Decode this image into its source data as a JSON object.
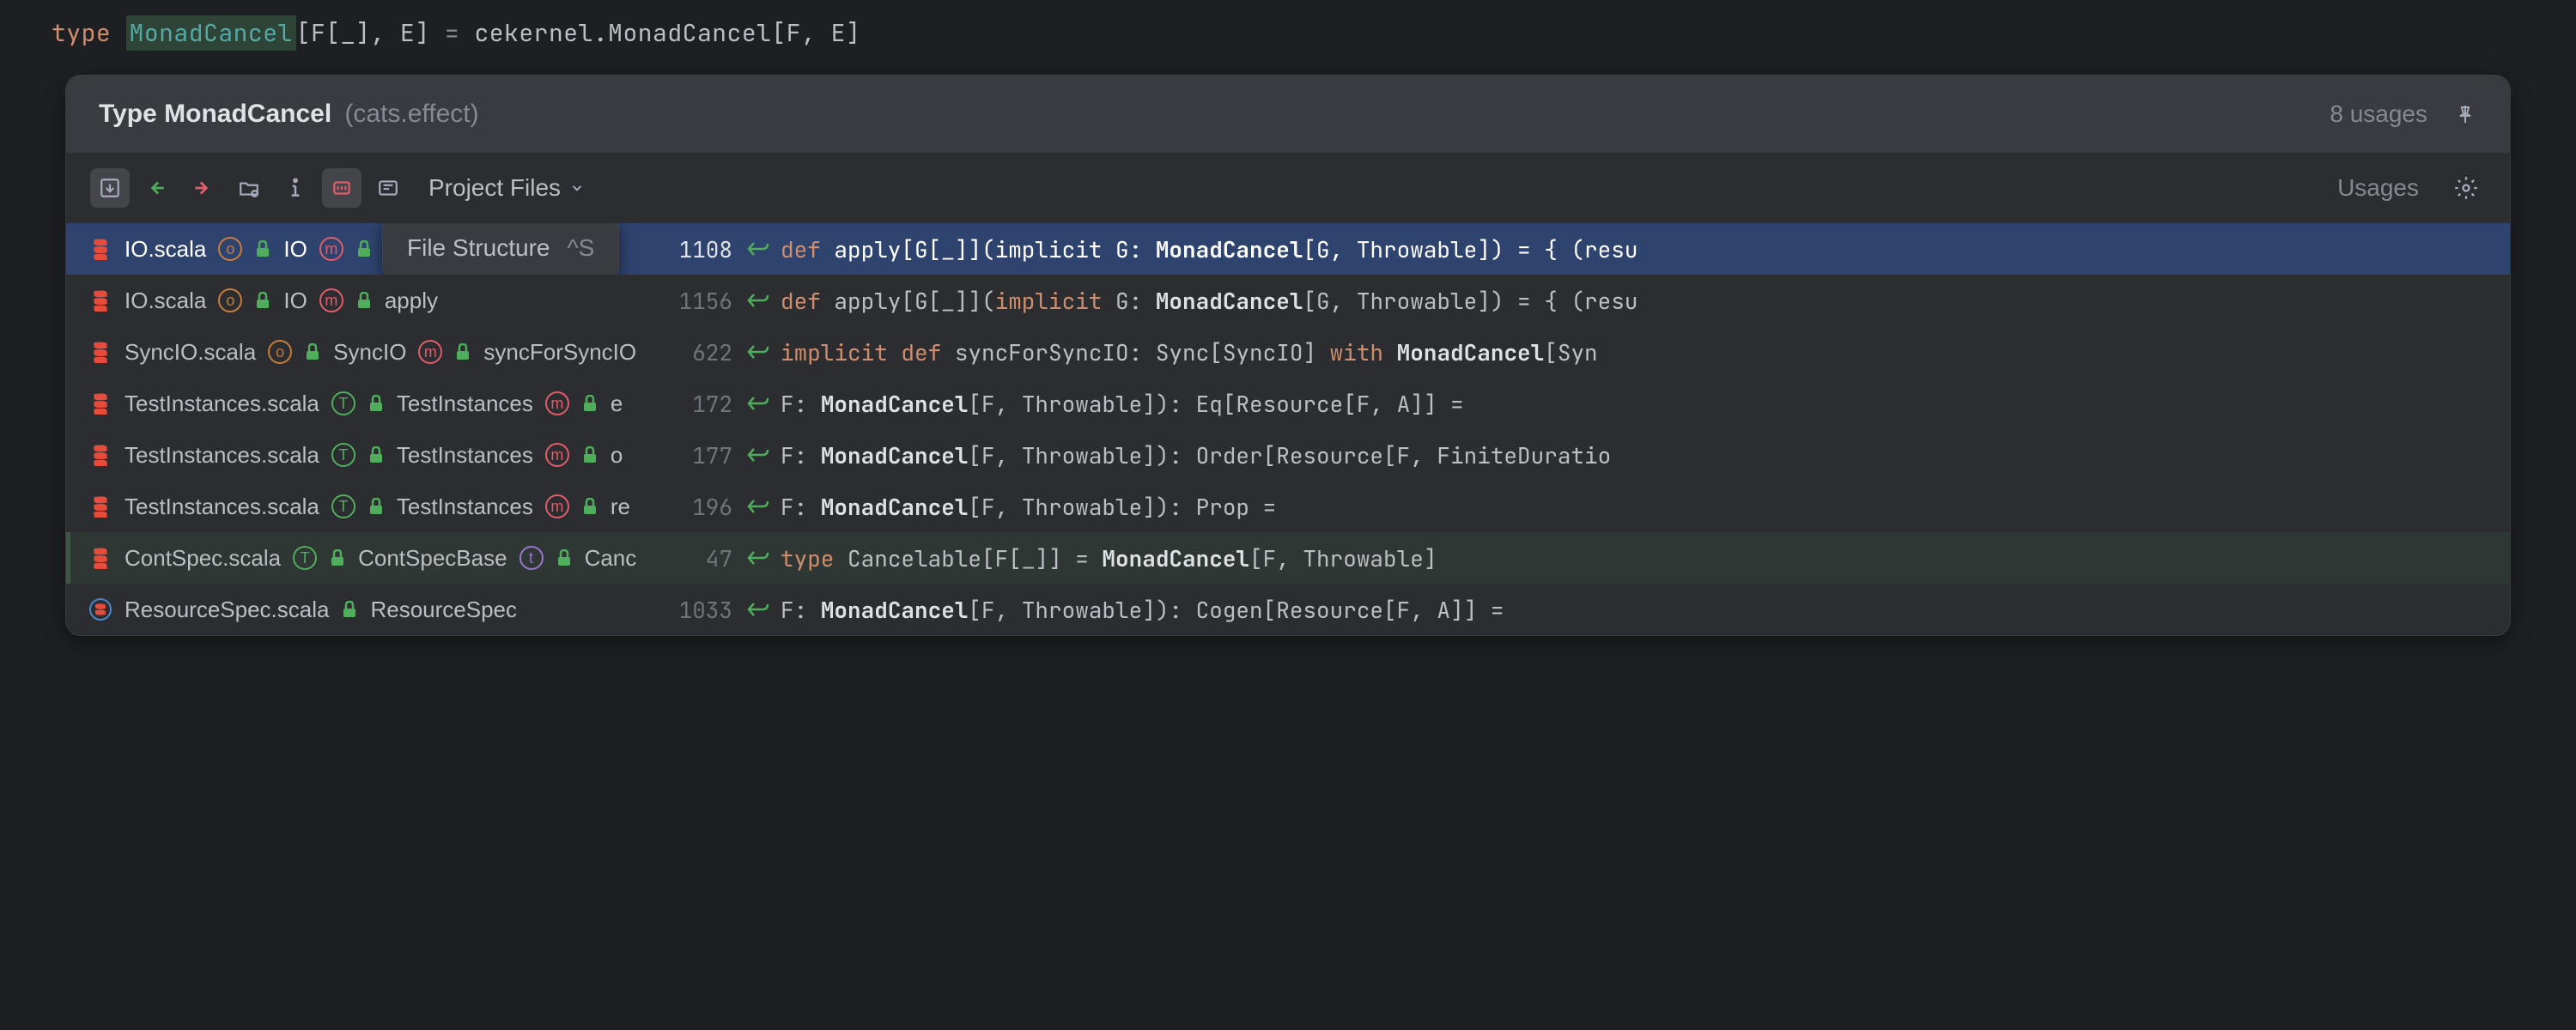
{
  "code_line": {
    "keyword": "type",
    "name": "MonadCancel",
    "params": "[F[_], E]",
    "eq": " = ",
    "rhs_pkg": "cekernel.",
    "rhs_name": "MonadCancel",
    "rhs_params": "[F, E]"
  },
  "popup": {
    "title": "Type MonadCancel",
    "subtitle": "(cats.effect)",
    "usage_count": "8 usages"
  },
  "toolbar": {
    "scope": "Project Files",
    "usages_label": "Usages"
  },
  "tooltip": {
    "label": "File Structure",
    "shortcut": "^S"
  },
  "rows": [
    {
      "file": "IO.scala",
      "chain": [
        {
          "kind": "object",
          "name": "IO"
        },
        {
          "kind": "method",
          "name": null
        }
      ],
      "line": "1108",
      "selected": true,
      "diff": null,
      "code": [
        {
          "t": "kw",
          "v": "def "
        },
        {
          "t": "plain",
          "v": "apply[G[_]](implicit G: "
        },
        {
          "t": "bold",
          "v": "MonadCancel"
        },
        {
          "t": "plain",
          "v": "[G, Throwable]) = { (resu"
        }
      ]
    },
    {
      "file": "IO.scala",
      "chain": [
        {
          "kind": "object",
          "name": "IO"
        },
        {
          "kind": "method",
          "name": "apply"
        }
      ],
      "line": "1156",
      "selected": false,
      "diff": null,
      "code": [
        {
          "t": "kw",
          "v": "def "
        },
        {
          "t": "plain",
          "v": "apply[G[_]]("
        },
        {
          "t": "kw",
          "v": "implicit"
        },
        {
          "t": "plain",
          "v": " G: "
        },
        {
          "t": "bold",
          "v": "MonadCancel"
        },
        {
          "t": "plain",
          "v": "[G, Throwable]) = { (resu"
        }
      ]
    },
    {
      "file": "SyncIO.scala",
      "chain": [
        {
          "kind": "object",
          "name": "SyncIO"
        },
        {
          "kind": "method",
          "name": "syncForSyncIO"
        }
      ],
      "line": "622",
      "selected": false,
      "diff": null,
      "code": [
        {
          "t": "kw",
          "v": "implicit def "
        },
        {
          "t": "plain",
          "v": "syncForSyncIO: Sync[SyncIO] "
        },
        {
          "t": "kw",
          "v": "with"
        },
        {
          "t": "plain",
          "v": " "
        },
        {
          "t": "bold",
          "v": "MonadCancel"
        },
        {
          "t": "plain",
          "v": "[Syn"
        }
      ]
    },
    {
      "file": "TestInstances.scala",
      "chain": [
        {
          "kind": "trait",
          "name": "TestInstances"
        },
        {
          "kind": "method",
          "name": "e"
        }
      ],
      "line": "172",
      "selected": false,
      "diff": null,
      "code": [
        {
          "t": "plain",
          "v": "F: "
        },
        {
          "t": "bold",
          "v": "MonadCancel"
        },
        {
          "t": "plain",
          "v": "[F, Throwable]): Eq[Resource[F, A]] ="
        }
      ]
    },
    {
      "file": "TestInstances.scala",
      "chain": [
        {
          "kind": "trait",
          "name": "TestInstances"
        },
        {
          "kind": "method",
          "name": "o"
        }
      ],
      "line": "177",
      "selected": false,
      "diff": null,
      "code": [
        {
          "t": "plain",
          "v": "F: "
        },
        {
          "t": "bold",
          "v": "MonadCancel"
        },
        {
          "t": "plain",
          "v": "[F, Throwable]): Order[Resource[F, FiniteDuratio"
        }
      ]
    },
    {
      "file": "TestInstances.scala",
      "chain": [
        {
          "kind": "trait",
          "name": "TestInstances"
        },
        {
          "kind": "method",
          "name": "re"
        }
      ],
      "line": "196",
      "selected": false,
      "diff": null,
      "code": [
        {
          "t": "plain",
          "v": "F: "
        },
        {
          "t": "bold",
          "v": "MonadCancel"
        },
        {
          "t": "plain",
          "v": "[F, Throwable]): Prop ="
        }
      ]
    },
    {
      "file": "ContSpec.scala",
      "chain": [
        {
          "kind": "trait",
          "name": "ContSpecBase"
        },
        {
          "kind": "type",
          "name": "Canc"
        }
      ],
      "line": "47",
      "selected": false,
      "diff": "green",
      "code": [
        {
          "t": "kw",
          "v": "type "
        },
        {
          "t": "plain",
          "v": "Cancelable[F[_]] = "
        },
        {
          "t": "bold",
          "v": "MonadCancel"
        },
        {
          "t": "plain",
          "v": "[F, Throwable]"
        }
      ]
    },
    {
      "file": "ResourceSpec.scala",
      "chain": [
        {
          "kind": "class",
          "name": "ResourceSpec"
        }
      ],
      "line": "1033",
      "selected": false,
      "diff": null,
      "code": [
        {
          "t": "plain",
          "v": "F: "
        },
        {
          "t": "bold",
          "v": "MonadCancel"
        },
        {
          "t": "plain",
          "v": "[F, Throwable]): Cogen[Resource[F, A]] ="
        }
      ]
    }
  ]
}
